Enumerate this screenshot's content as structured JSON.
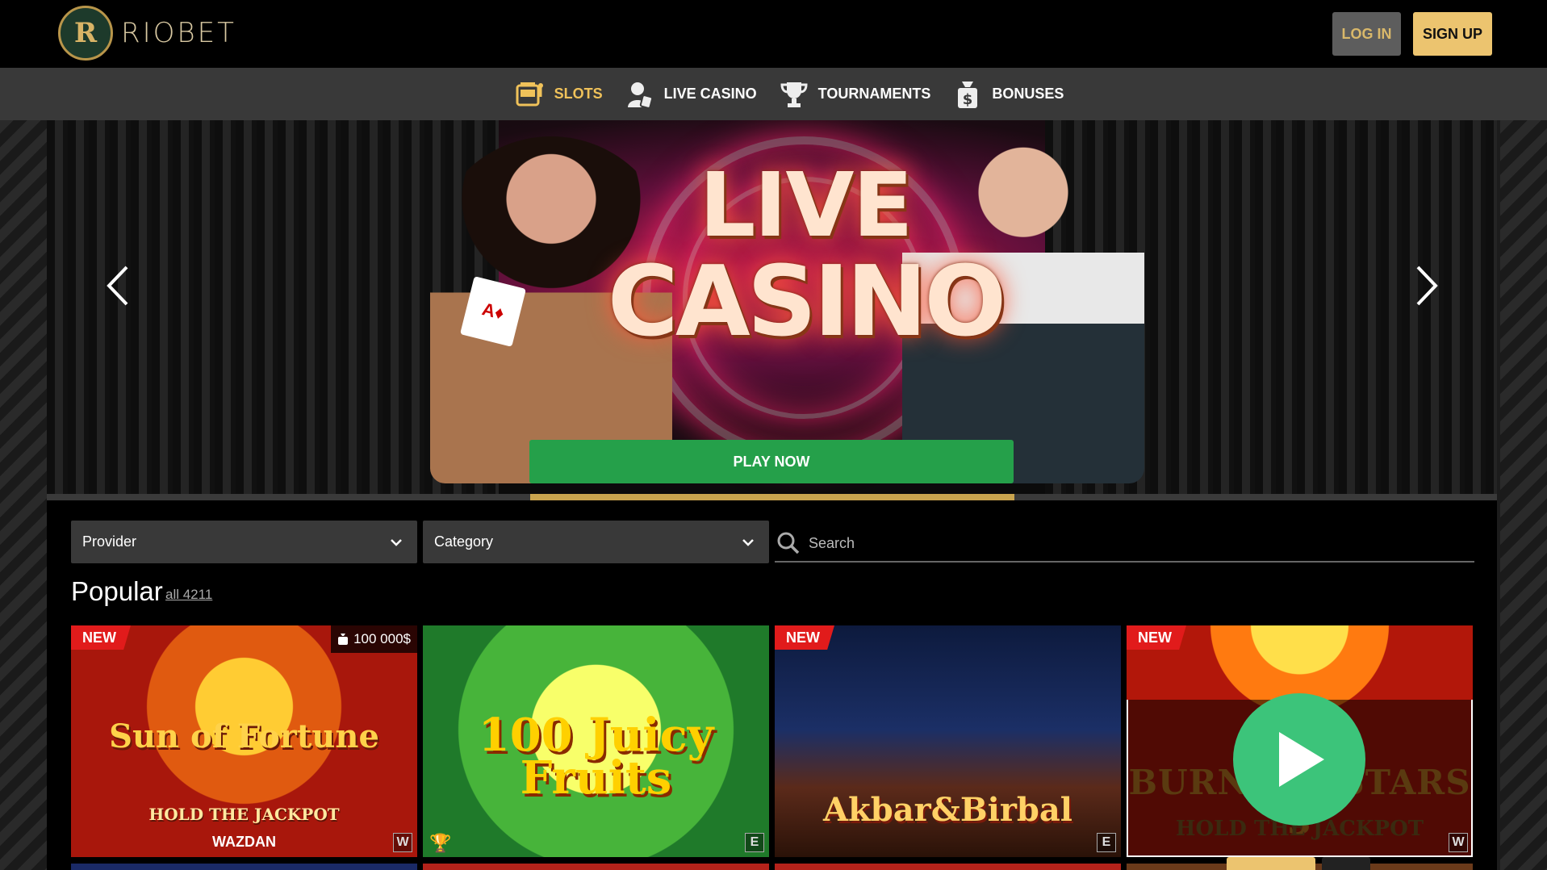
{
  "header": {
    "logo_text": "RIOBET",
    "login_label": "LOG IN",
    "signup_label": "SIGN UP"
  },
  "nav": {
    "items": [
      {
        "label": "SLOTS",
        "icon": "slot-machine-icon",
        "active": true
      },
      {
        "label": "LIVE CASINO",
        "icon": "dealer-icon",
        "active": false
      },
      {
        "label": "TOURNAMENTS",
        "icon": "trophy-icon",
        "active": false
      },
      {
        "label": "BONUSES",
        "icon": "money-bag-icon",
        "active": false
      }
    ]
  },
  "banner": {
    "title_line1": "LIVE",
    "title_line2": "CASINO",
    "cta_label": "PLAY NOW",
    "progress_fraction": 0.33
  },
  "filters": {
    "provider_label": "Provider",
    "category_label": "Category",
    "search_placeholder": "Search"
  },
  "section": {
    "title": "Popular",
    "all_link": "all 4211"
  },
  "games": [
    {
      "title": "Sun of Fortune",
      "subtitle": "HOLD THE JACKPOT",
      "brand": "WAZDAN",
      "badge": "NEW",
      "jackpot": "100 000$"
    },
    {
      "title": "100 Juicy Fruits",
      "badge": ""
    },
    {
      "title": "Akbar&Birbal",
      "badge": "NEW"
    },
    {
      "title": "BURNING STARS 3",
      "subtitle": "HOLD THE JACKPOT",
      "badge": "NEW"
    }
  ],
  "colors": {
    "accent_gold": "#ecc46f",
    "play_green": "#25a04a",
    "badge_red": "#e11b1b",
    "nav_bg": "#393939"
  }
}
